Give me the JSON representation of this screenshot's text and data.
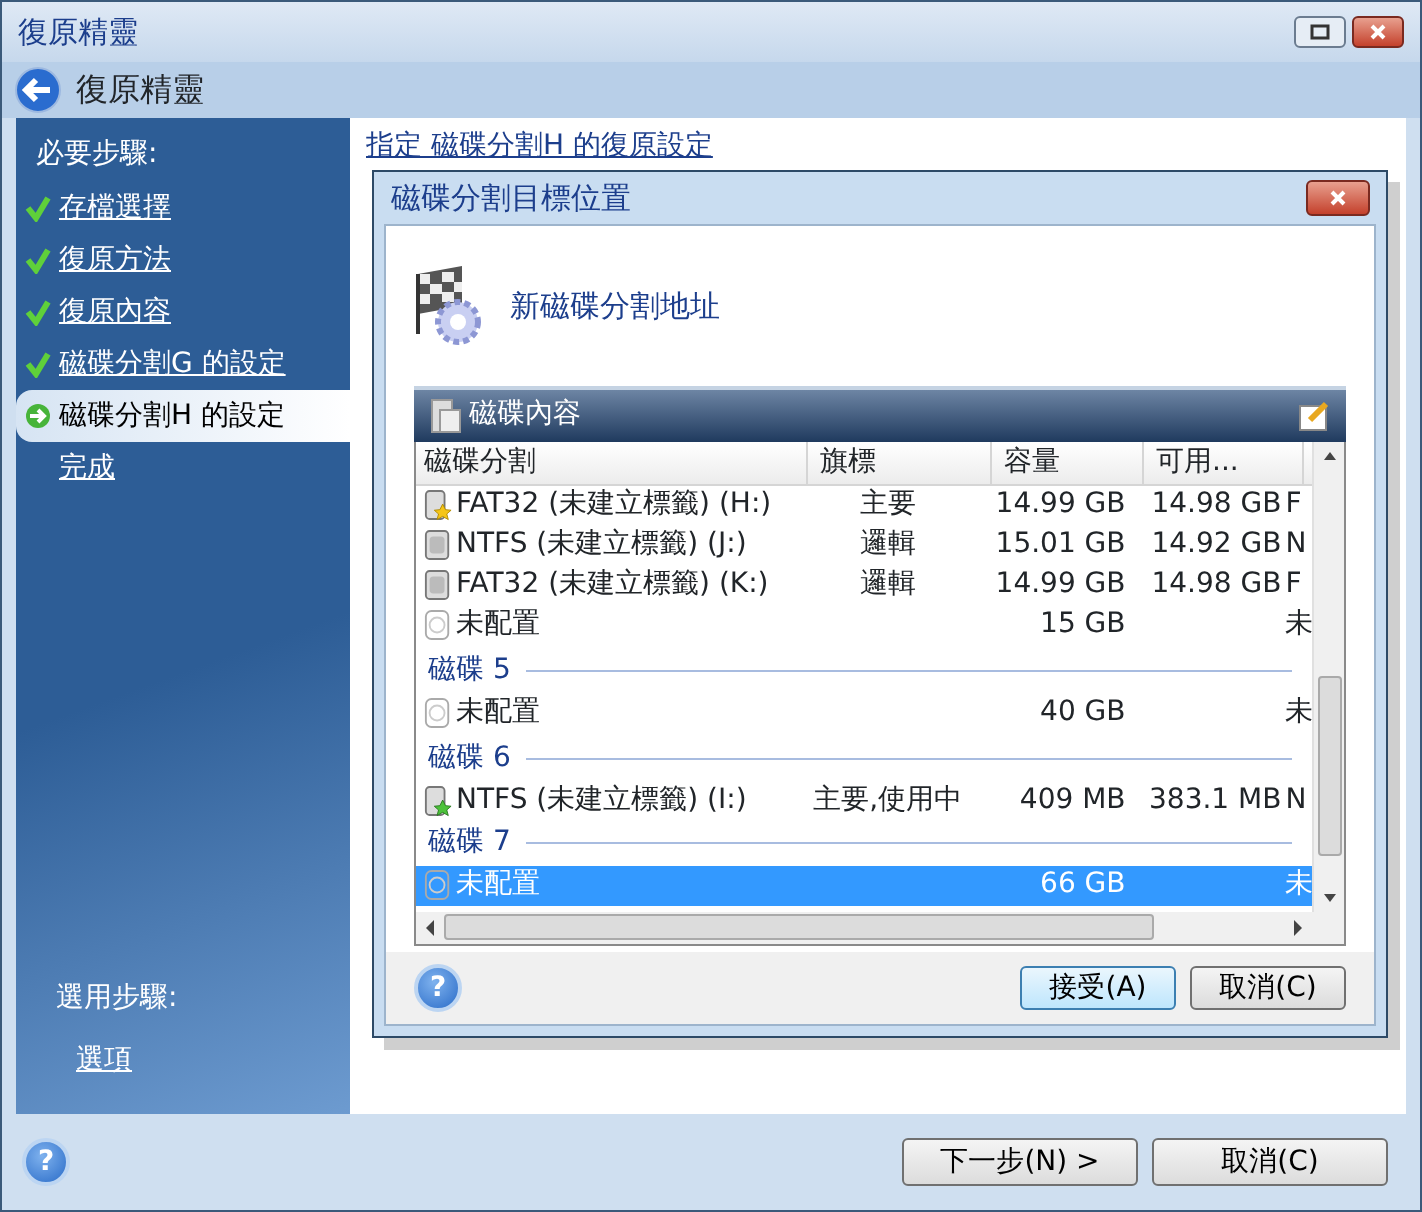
{
  "window": {
    "title": "復原精靈",
    "header": "復原精靈"
  },
  "sidebar": {
    "required_heading": "必要步驟:",
    "steps": [
      {
        "label": "存檔選擇",
        "done": true,
        "selected": false
      },
      {
        "label": "復原方法",
        "done": true,
        "selected": false
      },
      {
        "label": "復原內容",
        "done": true,
        "selected": false
      },
      {
        "label": "磁碟分割G 的設定",
        "done": true,
        "selected": false
      },
      {
        "label": "磁碟分割H 的設定",
        "done": false,
        "selected": true
      },
      {
        "label": "完成",
        "done": false,
        "selected": false
      }
    ],
    "optional_heading": "選用步驟:",
    "optional_steps": [
      {
        "label": "選項",
        "done": false,
        "selected": false
      }
    ]
  },
  "content": {
    "heading": "指定 磁碟分割H 的復原設定"
  },
  "dialog": {
    "title": "磁碟分割目標位置",
    "header": "新磁碟分割地址",
    "panel_title": "磁碟內容",
    "table": {
      "columns": [
        "磁碟分割",
        "旗標",
        "容量",
        "可用..."
      ],
      "rows": [
        {
          "kind": "primary",
          "cells": [
            "FAT32 (未建立標籤) (H:)",
            "主要",
            "14.99 GB",
            "14.98 GB",
            "F"
          ],
          "selected": false
        },
        {
          "kind": "logical",
          "cells": [
            "NTFS (未建立標籤) (J:)",
            "邏輯",
            "15.01 GB",
            "14.92 GB",
            "N"
          ],
          "selected": false
        },
        {
          "kind": "logical",
          "cells": [
            "FAT32 (未建立標籤) (K:)",
            "邏輯",
            "14.99 GB",
            "14.98 GB",
            "F"
          ],
          "selected": false
        },
        {
          "kind": "unallocated",
          "cells": [
            "未配置",
            "",
            "15 GB",
            "",
            "未"
          ],
          "selected": false
        },
        {
          "kind": "disk",
          "label": "磁碟 5"
        },
        {
          "kind": "unallocated",
          "cells": [
            "未配置",
            "",
            "40 GB",
            "",
            "未"
          ],
          "selected": false
        },
        {
          "kind": "disk",
          "label": "磁碟 6"
        },
        {
          "kind": "active",
          "cells": [
            "NTFS (未建立標籤) (I:)",
            "主要,使用中",
            "409 MB",
            "383.1 MB",
            "N"
          ],
          "selected": false
        },
        {
          "kind": "disk",
          "label": "磁碟 7"
        },
        {
          "kind": "unallocated",
          "cells": [
            "未配置",
            "",
            "66 GB",
            "",
            "未"
          ],
          "selected": true
        }
      ]
    },
    "help_label": "?",
    "buttons": [
      "接受(A)",
      "取消(C)"
    ]
  },
  "help_label": "?",
  "buttons": [
    "下一步(N) >",
    "取消(C)"
  ]
}
